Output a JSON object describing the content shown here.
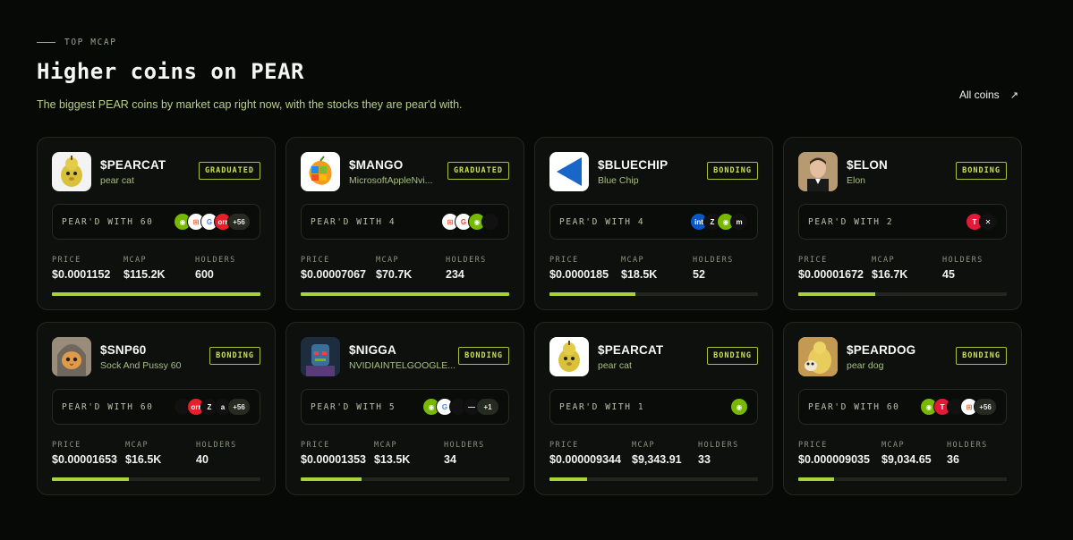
{
  "section_tag": "TOP MCAP",
  "title": "Higher coins on PEAR",
  "subtitle": "The biggest PEAR coins by market cap right now, with the stocks they are pear'd with.",
  "all_coins": "All coins",
  "labels": {
    "price": "PRICE",
    "mcap": "MCAP",
    "holders": "HOLDERS"
  },
  "accent_color": "#a8d13a",
  "cards": [
    {
      "ticker": "$PEARCAT",
      "name": "pear cat",
      "badge": "GRADUATED",
      "pear_label": "PEAR'D WITH 60",
      "avatar_icon": "pear-cat-avatar",
      "avatar_bg": "#f3f3f3",
      "logos": [
        {
          "icon": "nvidia-logo",
          "bg": "#76b900",
          "text": "◉"
        },
        {
          "icon": "microsoft-logo",
          "bg": "#ffffff",
          "text": "⊞",
          "color": "#f25022"
        },
        {
          "icon": "google-logo",
          "bg": "#ffffff",
          "text": "G",
          "color": "#4285f4"
        },
        {
          "icon": "oracle-logo",
          "bg": "#e6202a",
          "text": "orr"
        }
      ],
      "more": "+56",
      "price": "$0.0001152",
      "mcap": "$115.2K",
      "holders": "600",
      "progress": 1.0
    },
    {
      "ticker": "$MANGO",
      "name": "MicrosoftAppleNvi...",
      "badge": "GRADUATED",
      "pear_label": "PEAR'D WITH 4",
      "avatar_icon": "mango-avatar",
      "avatar_bg": "#ffffff",
      "logos": [
        {
          "icon": "microsoft-logo",
          "bg": "#ffffff",
          "text": "⊞",
          "color": "#f25022"
        },
        {
          "icon": "google-logo",
          "bg": "#ffffff",
          "text": "G",
          "color": "#ea4335"
        },
        {
          "icon": "nvidia-logo",
          "bg": "#76b900",
          "text": "◉"
        },
        {
          "icon": "apple-logo",
          "bg": "#111111",
          "text": ""
        }
      ],
      "more": "",
      "price": "$0.00007067",
      "mcap": "$70.7K",
      "holders": "234",
      "progress": 1.0
    },
    {
      "ticker": "$BLUECHIP",
      "name": "Blue Chip",
      "badge": "BONDING",
      "pear_label": "PEAR'D WITH 4",
      "avatar_icon": "blue-triangle-avatar",
      "avatar_bg": "#ffffff",
      "logos": [
        {
          "icon": "intel-logo",
          "bg": "#0a58c8",
          "text": "int"
        },
        {
          "icon": "tesla-logo",
          "bg": "#111111",
          "text": "Z"
        },
        {
          "icon": "nvidia-logo",
          "bg": "#76b900",
          "text": "◉"
        },
        {
          "icon": "meta-logo",
          "bg": "#111111",
          "text": "m"
        }
      ],
      "more": "",
      "price": "$0.0000185",
      "mcap": "$18.5K",
      "holders": "52",
      "progress": 0.41
    },
    {
      "ticker": "$ELON",
      "name": "Elon",
      "badge": "BONDING",
      "pear_label": "PEAR'D WITH 2",
      "avatar_icon": "elon-avatar",
      "avatar_bg": "#6b5a42",
      "logos": [
        {
          "icon": "tesla-logo",
          "bg": "#e31937",
          "text": "T"
        },
        {
          "icon": "x-logo",
          "bg": "#111111",
          "text": "✕"
        }
      ],
      "more": "",
      "price": "$0.00001672",
      "mcap": "$16.7K",
      "holders": "45",
      "progress": 0.37
    },
    {
      "ticker": "$SNP60",
      "name": "Sock And Pussy 60",
      "badge": "BONDING",
      "pear_label": "PEAR'D WITH 60",
      "avatar_icon": "cat-hoodie-avatar",
      "avatar_bg": "#8a7a66",
      "logos": [
        {
          "icon": "apple-logo",
          "bg": "#111111",
          "text": ""
        },
        {
          "icon": "oracle-logo",
          "bg": "#e6202a",
          "text": "orr"
        },
        {
          "icon": "tesla-logo",
          "bg": "#111111",
          "text": "Z"
        },
        {
          "icon": "amazon-logo",
          "bg": "#111111",
          "text": "a"
        }
      ],
      "more": "+56",
      "price": "$0.00001653",
      "mcap": "$16.5K",
      "holders": "40",
      "progress": 0.37
    },
    {
      "ticker": "$NIGGA",
      "name": "NVIDIAINTELGOOGLE...",
      "badge": "BONDING",
      "pear_label": "PEAR'D WITH 5",
      "avatar_icon": "robot-avatar",
      "avatar_bg": "#1d3a55",
      "logos": [
        {
          "icon": "nvidia-logo",
          "bg": "#76b900",
          "text": "◉"
        },
        {
          "icon": "google-logo",
          "bg": "#ffffff",
          "text": "G",
          "color": "#4285f4"
        },
        {
          "icon": "apple-logo",
          "bg": "#111111",
          "text": ""
        },
        {
          "icon": "intel-logo",
          "bg": "#111111",
          "text": "—"
        }
      ],
      "more": "+1",
      "price": "$0.00001353",
      "mcap": "$13.5K",
      "holders": "34",
      "progress": 0.29
    },
    {
      "ticker": "$PEARCAT",
      "name": "pear cat",
      "badge": "BONDING",
      "pear_label": "PEAR'D WITH 1",
      "avatar_icon": "pear-cat-avatar",
      "avatar_bg": "#ffffff",
      "logos": [
        {
          "icon": "nvidia-logo",
          "bg": "#76b900",
          "text": "◉"
        }
      ],
      "more": "",
      "price": "$0.000009344",
      "mcap": "$9,343.91",
      "holders": "33",
      "progress": 0.18
    },
    {
      "ticker": "$PEARDOG",
      "name": "pear dog",
      "badge": "BONDING",
      "pear_label": "PEAR'D WITH 60",
      "avatar_icon": "pear-dog-avatar",
      "avatar_bg": "#c49a52",
      "logos": [
        {
          "icon": "nvidia-logo",
          "bg": "#76b900",
          "text": "◉"
        },
        {
          "icon": "tesla-logo",
          "bg": "#e31937",
          "text": "T"
        },
        {
          "icon": "apple-logo",
          "bg": "#111111",
          "text": ""
        },
        {
          "icon": "microsoft-logo",
          "bg": "#ffffff",
          "text": "⊞",
          "color": "#f25022"
        }
      ],
      "more": "+56",
      "price": "$0.000009035",
      "mcap": "$9,034.65",
      "holders": "36",
      "progress": 0.17
    }
  ]
}
